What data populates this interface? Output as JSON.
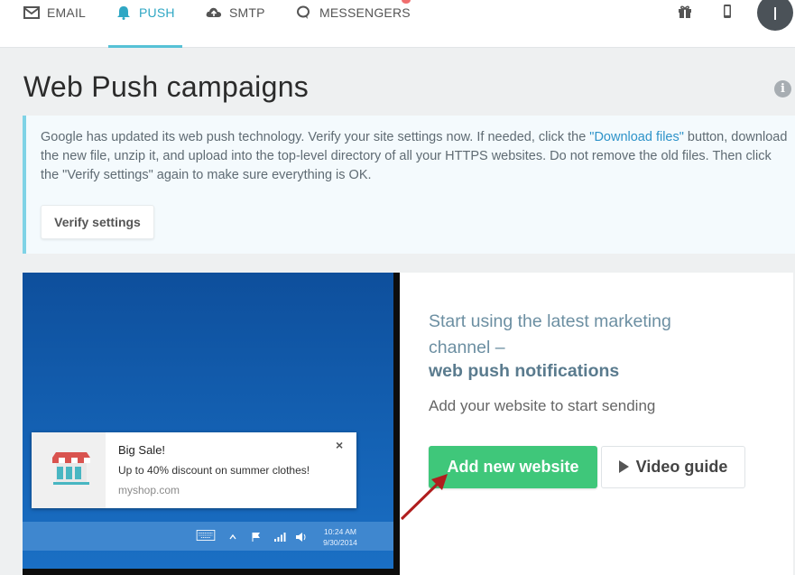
{
  "nav": {
    "tabs": [
      {
        "label": "EMAIL",
        "icon": "envelope-icon"
      },
      {
        "label": "PUSH",
        "icon": "bell-icon"
      },
      {
        "label": "SMTP",
        "icon": "cloud-upload-icon"
      },
      {
        "label": "MESSENGERS",
        "icon": "chat-bubble-icon"
      }
    ],
    "active_tab": "PUSH",
    "avatar_initial": "I",
    "icons": [
      "gift-icon",
      "mobile-icon"
    ]
  },
  "page": {
    "title": "Web Push campaigns"
  },
  "alert": {
    "text_before": "Google has updated its web push technology. Verify your site settings now. If needed, click the ",
    "link_text": "\"Download files\"",
    "text_after": " button, download the new file, unzip it, and upload into the top-level directory of all your HTTPS websites. Do not remove the old files. Then click the \"Verify settings\" again to make sure everything is OK.",
    "verify_button": "Verify settings"
  },
  "preview": {
    "notification": {
      "title": "Big Sale!",
      "body": "Up to 40% discount on summer clothes!",
      "source": "myshop.com",
      "close": "×"
    },
    "clock_time": "10:24 AM",
    "clock_date": "9/30/2014"
  },
  "promo": {
    "line1": "Start using the latest marketing channel –",
    "line2": "web push notifications",
    "line3": "Add your website to start sending",
    "add_button": "Add new website",
    "video_button": "Video guide"
  },
  "colors": {
    "accent": "#2fa7c4",
    "primary_button": "#3fc77a",
    "arrow": "#b01e1e"
  }
}
